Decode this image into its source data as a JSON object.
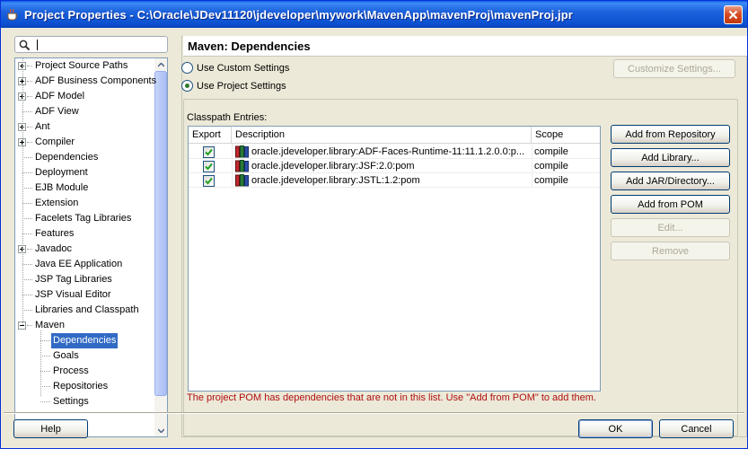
{
  "window": {
    "title": "Project Properties - C:\\Oracle\\JDev11120\\jdeveloper\\mywork\\MavenApp\\mavenProj\\mavenProj.jpr"
  },
  "search": {
    "value": ""
  },
  "tree": {
    "items": [
      {
        "label": "Project Source Paths",
        "expander": "plus"
      },
      {
        "label": "ADF Business Components",
        "expander": "plus"
      },
      {
        "label": "ADF Model",
        "expander": "plus"
      },
      {
        "label": "ADF View",
        "expander": "none"
      },
      {
        "label": "Ant",
        "expander": "plus"
      },
      {
        "label": "Compiler",
        "expander": "plus"
      },
      {
        "label": "Dependencies",
        "expander": "none"
      },
      {
        "label": "Deployment",
        "expander": "none"
      },
      {
        "label": "EJB Module",
        "expander": "none"
      },
      {
        "label": "Extension",
        "expander": "none"
      },
      {
        "label": "Facelets Tag Libraries",
        "expander": "none"
      },
      {
        "label": "Features",
        "expander": "none"
      },
      {
        "label": "Javadoc",
        "expander": "plus"
      },
      {
        "label": "Java EE Application",
        "expander": "none"
      },
      {
        "label": "JSP Tag Libraries",
        "expander": "none"
      },
      {
        "label": "JSP Visual Editor",
        "expander": "none"
      },
      {
        "label": "Libraries and Classpath",
        "expander": "none"
      },
      {
        "label": "Maven",
        "expander": "minus"
      },
      {
        "label": "Dependencies",
        "expander": "child",
        "selected": true
      },
      {
        "label": "Goals",
        "expander": "child"
      },
      {
        "label": "Process",
        "expander": "child"
      },
      {
        "label": "Repositories",
        "expander": "child"
      },
      {
        "label": "Settings",
        "expander": "child"
      }
    ]
  },
  "panel": {
    "title": "Maven: Dependencies",
    "radio_custom": "Use Custom Settings",
    "radio_project": "Use Project Settings",
    "customize_button": "Customize Settings...",
    "classpath_label": "Classpath Entries:",
    "columns": [
      "Export",
      "Description",
      "Scope"
    ],
    "rows": [
      {
        "exported": true,
        "description": "oracle.jdeveloper.library:ADF-Faces-Runtime-11:11.1.2.0.0:p...",
        "scope": "compile"
      },
      {
        "exported": true,
        "description": "oracle.jdeveloper.library:JSF:2.0:pom",
        "scope": "compile"
      },
      {
        "exported": true,
        "description": "oracle.jdeveloper.library:JSTL:1.2:pom",
        "scope": "compile"
      }
    ],
    "buttons": {
      "add_from_repository": "Add from Repository",
      "add_library": "Add Library...",
      "add_jar": "Add JAR/Directory...",
      "add_from_pom": "Add from POM",
      "edit": "Edit...",
      "remove": "Remove"
    },
    "warning": "The project POM has dependencies that are not in this list. Use \"Add from POM\" to add them."
  },
  "footer": {
    "help": "Help",
    "ok": "OK",
    "cancel": "Cancel"
  },
  "colors": {
    "titlebar": "#0b4fcf",
    "selection": "#316ac5",
    "warning": "#b01010"
  }
}
